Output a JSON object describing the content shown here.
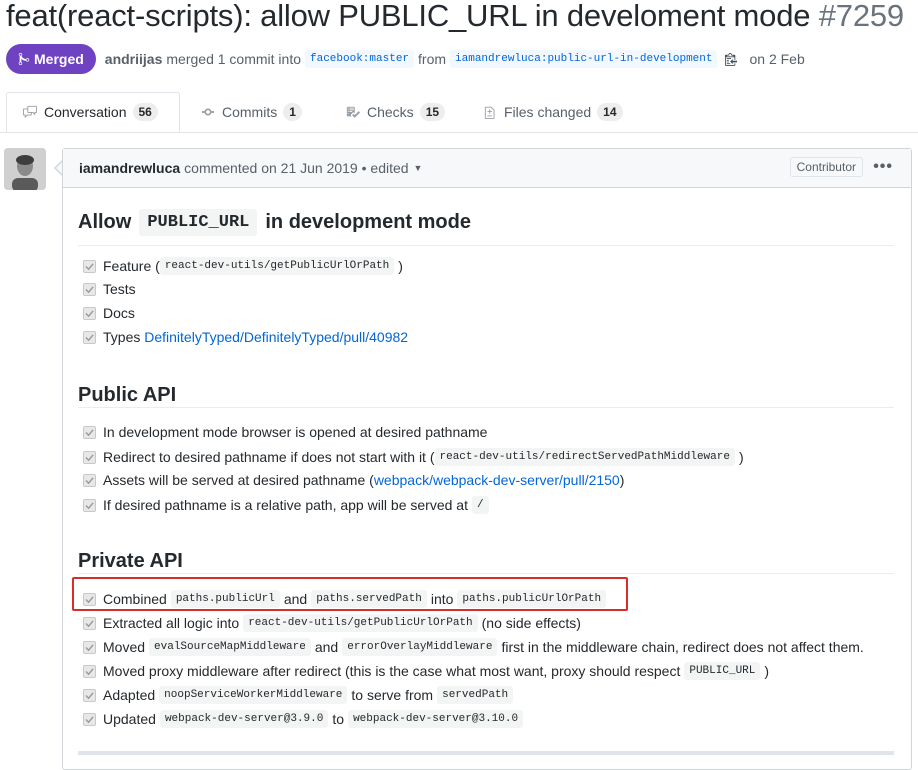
{
  "pr": {
    "title": "feat(react-scripts): allow PUBLIC_URL in develoment mode",
    "number": "#7259",
    "status": "Merged",
    "merger": "andriijas",
    "merged_text": "merged 1 commit into",
    "base_branch": "facebook:master",
    "from_text": "from",
    "head_branch": "iamandrewluca:public-url-in-development",
    "date_text": "on 2 Feb"
  },
  "tabs": [
    {
      "label": "Conversation",
      "count": "56",
      "icon": "comment-icon"
    },
    {
      "label": "Commits",
      "count": "1",
      "icon": "commit-icon"
    },
    {
      "label": "Checks",
      "count": "15",
      "icon": "checklist-icon"
    },
    {
      "label": "Files changed",
      "count": "14",
      "icon": "diff-icon"
    }
  ],
  "comment": {
    "author": "iamandrewluca",
    "meta": "commented on 21 Jun 2019 • edited",
    "role": "Contributor",
    "more": "•••",
    "heading": {
      "pre": "Allow",
      "code": "PUBLIC_URL",
      "post": "in development mode"
    },
    "list1": {
      "feature_text": "Feature (",
      "feature_code": "react-dev-utils/getPublicUrlOrPath",
      "feature_close": ")",
      "tests": "Tests",
      "docs": "Docs",
      "types_text": "Types",
      "types_link": "DefinitelyTyped/DefinitelyTyped/pull/40982"
    },
    "public_api": {
      "title": "Public API",
      "i1": "In development mode browser is opened at desired pathname",
      "i2_text": "Redirect to desired pathname if does not start with it (",
      "i2_code": "react-dev-utils/redirectServedPathMiddleware",
      "i2_close": ")",
      "i3_text": "Assets will be served at desired pathname (",
      "i3_link": "webpack/webpack-dev-server/pull/2150",
      "i3_close": ")",
      "i4_text": "If desired pathname is a relative path, app will be served at",
      "i4_code": "/"
    },
    "private_api": {
      "title": "Private API",
      "p1_a": "Combined",
      "p1_c1": "paths.publicUrl",
      "p1_b": "and",
      "p1_c2": "paths.servedPath",
      "p1_d": "into",
      "p1_c3": "paths.publicUrlOrPath",
      "p2_a": "Extracted all logic into",
      "p2_c": "react-dev-utils/getPublicUrlOrPath",
      "p2_b": "(no side effects)",
      "p3_a": "Moved",
      "p3_c1": "evalSourceMapMiddleware",
      "p3_b": "and",
      "p3_c2": "errorOverlayMiddleware",
      "p3_d": "first in the middleware chain, redirect does not affect them.",
      "p4_a": "Moved proxy middleware after redirect (this is the case what most want, proxy should respect",
      "p4_c": "PUBLIC_URL",
      "p4_b": ")",
      "p5_a": "Adapted",
      "p5_c1": "noopServiceWorkerMiddleware",
      "p5_b": "to serve from",
      "p5_c2": "servedPath",
      "p6_a": "Updated",
      "p6_c1": "webpack-dev-server@3.9.0",
      "p6_b": "to",
      "p6_c2": "webpack-dev-server@3.10.0"
    }
  },
  "colors": {
    "merged": "#6f42c1",
    "link": "#0366d6",
    "highlight": "#d92d27"
  }
}
